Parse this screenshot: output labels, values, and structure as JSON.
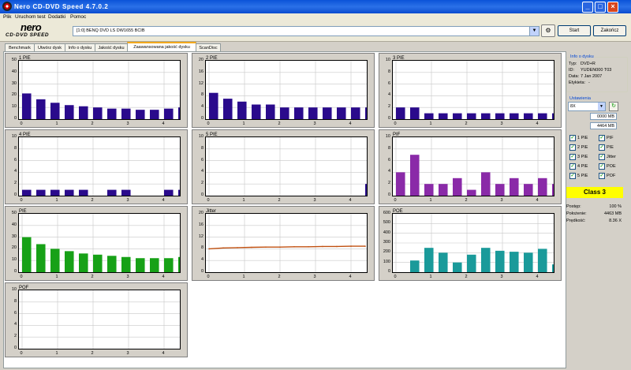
{
  "window": {
    "title": "Nero CD-DVD Speed 4.7.0.2"
  },
  "menu": [
    "Plik",
    "Uruchom test",
    "Dodatki",
    "Pomoc"
  ],
  "logo": {
    "brand": "nero",
    "product": "CD·DVD SPEED"
  },
  "drive": {
    "selected": "[1:0]  BENQ DVD LS DW1655 BCIB"
  },
  "buttons": {
    "start": "Start",
    "close": "Zakończ"
  },
  "tabs": [
    "Benchmark",
    "Utwórz dysk",
    "Info o dysku",
    "Jakość dysku",
    "Zaawansowana jakość dysku",
    "ScanDisc"
  ],
  "active_tab": 4,
  "disc_info": {
    "heading": "Info o dysku",
    "rows": [
      {
        "label": "Typ:",
        "value": "DVD+R"
      },
      {
        "label": "ID:",
        "value": "YUDEN000 T03"
      },
      {
        "label": "Data:",
        "value": "7 Jan 2007"
      },
      {
        "label": "Etykieta:",
        "value": "-"
      }
    ]
  },
  "settings": {
    "heading": "Ustawienia",
    "speed": "8X",
    "start_mb": "0000 MB",
    "end_mb": "4464 MB",
    "checkboxes": [
      {
        "label": "1 PIE",
        "checked": true
      },
      {
        "label": "PIF",
        "checked": true
      },
      {
        "label": "2 PIE",
        "checked": true
      },
      {
        "label": "PIE",
        "checked": true
      },
      {
        "label": "3 PIE",
        "checked": true
      },
      {
        "label": "Jitter",
        "checked": true
      },
      {
        "label": "4 PIE",
        "checked": true
      },
      {
        "label": "POE",
        "checked": true
      },
      {
        "label": "5 PIE",
        "checked": true
      },
      {
        "label": "POF",
        "checked": true
      }
    ]
  },
  "quality_class": "Class 3",
  "status": [
    {
      "label": "Postęp:",
      "value": "100 %"
    },
    {
      "label": "Położenie:",
      "value": "4463 MB"
    },
    {
      "label": "Prędkość:",
      "value": "8.36 X"
    }
  ],
  "colors": {
    "pie": "#2a0a8c",
    "pif": "#8a2aa8",
    "pie_total": "#17a117",
    "jitter": "#c05010",
    "poe": "#1a9a9a",
    "class_badge": "#ffff00"
  },
  "chart_data": [
    {
      "type": "bar",
      "title": "1 PIE",
      "yticks": [
        "50",
        "40",
        "30",
        "20",
        "10",
        "0"
      ],
      "ylim": [
        0,
        50
      ],
      "xticks": [
        "0",
        "1",
        "2",
        "3",
        "4"
      ],
      "xlim": [
        0,
        4.4
      ],
      "series": [
        {
          "x": [
            0,
            0.4,
            0.8,
            1.2,
            1.6,
            2.0,
            2.4,
            2.8,
            3.2,
            3.6,
            4.0,
            4.4
          ],
          "values": [
            22,
            17,
            14,
            12,
            11,
            10,
            9,
            9,
            8,
            8,
            9,
            10
          ]
        }
      ]
    },
    {
      "type": "bar",
      "title": "2 PIE",
      "yticks": [
        "20",
        "16",
        "12",
        "8",
        "4",
        "0"
      ],
      "ylim": [
        0,
        20
      ],
      "xticks": [
        "0",
        "1",
        "2",
        "3",
        "4"
      ],
      "xlim": [
        0,
        4.4
      ],
      "series": [
        {
          "x": [
            0,
            0.4,
            0.8,
            1.2,
            1.6,
            2.0,
            2.4,
            2.8,
            3.2,
            3.6,
            4.0,
            4.4
          ],
          "values": [
            9,
            7,
            6,
            5,
            5,
            4,
            4,
            4,
            4,
            4,
            4,
            4
          ]
        }
      ]
    },
    {
      "type": "bar",
      "title": "3 PIE",
      "yticks": [
        "10",
        "8",
        "6",
        "4",
        "2",
        "0"
      ],
      "ylim": [
        0,
        10
      ],
      "xticks": [
        "0",
        "1",
        "2",
        "3",
        "4"
      ],
      "xlim": [
        0,
        4.4
      ],
      "series": [
        {
          "x": [
            0,
            0.4,
            0.8,
            1.2,
            1.6,
            2.0,
            2.4,
            2.8,
            3.2,
            3.6,
            4.0,
            4.4
          ],
          "values": [
            2,
            2,
            1,
            1,
            1,
            1,
            1,
            1,
            1,
            1,
            1,
            1
          ]
        }
      ]
    },
    {
      "type": "bar",
      "title": "4 PIE",
      "yticks": [
        "10",
        "8",
        "6",
        "4",
        "2",
        "0"
      ],
      "ylim": [
        0,
        10
      ],
      "xticks": [
        "0",
        "1",
        "2",
        "3",
        "4"
      ],
      "xlim": [
        0,
        4.4
      ],
      "series": [
        {
          "x": [
            0,
            0.4,
            0.8,
            1.2,
            1.6,
            2.0,
            2.4,
            2.8,
            3.2,
            3.6,
            4.0,
            4.4
          ],
          "values": [
            1,
            1,
            1,
            1,
            1,
            0,
            1,
            1,
            0,
            0,
            1,
            1
          ]
        }
      ]
    },
    {
      "type": "bar",
      "title": "5 PIE",
      "yticks": [
        "10",
        "8",
        "6",
        "4",
        "2",
        "0"
      ],
      "ylim": [
        0,
        10
      ],
      "xticks": [
        "0",
        "1",
        "2",
        "3",
        "4"
      ],
      "xlim": [
        0,
        4.4
      ],
      "series": [
        {
          "x": [
            0,
            0.4,
            0.8,
            1.2,
            1.6,
            2.0,
            2.4,
            2.8,
            3.2,
            3.6,
            4.0,
            4.4
          ],
          "values": [
            0,
            0,
            0,
            0,
            0,
            0,
            0,
            0,
            0,
            0,
            0,
            2
          ]
        }
      ]
    },
    {
      "type": "bar",
      "title": "PIF",
      "yticks": [
        "10",
        "8",
        "6",
        "4",
        "2",
        "0"
      ],
      "ylim": [
        0,
        10
      ],
      "xticks": [
        "0",
        "1",
        "2",
        "3",
        "4"
      ],
      "xlim": [
        0,
        4.4
      ],
      "series": [
        {
          "x": [
            0,
            0.4,
            0.8,
            1.2,
            1.6,
            2.0,
            2.4,
            2.8,
            3.2,
            3.6,
            4.0,
            4.4
          ],
          "values": [
            4,
            7,
            2,
            2,
            3,
            1,
            4,
            2,
            3,
            2,
            3,
            2
          ]
        }
      ]
    },
    {
      "type": "bar",
      "title": "PIE",
      "yticks": [
        "50",
        "40",
        "30",
        "20",
        "10",
        "0"
      ],
      "ylim": [
        0,
        50
      ],
      "xticks": [
        "0",
        "1",
        "2",
        "3",
        "4"
      ],
      "xlim": [
        0,
        4.4
      ],
      "series": [
        {
          "x": [
            0,
            0.4,
            0.8,
            1.2,
            1.6,
            2.0,
            2.4,
            2.8,
            3.2,
            3.6,
            4.0,
            4.4
          ],
          "values": [
            30,
            24,
            20,
            18,
            16,
            15,
            14,
            13,
            12,
            12,
            12,
            13
          ]
        }
      ]
    },
    {
      "type": "line",
      "title": "Jitter",
      "yticks": [
        "20",
        "16",
        "12",
        "8",
        "4",
        "0"
      ],
      "ylim": [
        0,
        20
      ],
      "xticks": [
        "0",
        "1",
        "2",
        "3",
        "4"
      ],
      "xlim": [
        0,
        4.4
      ],
      "series": [
        {
          "x": [
            0,
            0.4,
            0.8,
            1.2,
            1.6,
            2.0,
            2.4,
            2.8,
            3.2,
            3.6,
            4.0,
            4.4
          ],
          "values": [
            8,
            8.3,
            8.4,
            8.5,
            8.6,
            8.6,
            8.7,
            8.7,
            8.8,
            8.8,
            8.9,
            8.9
          ]
        }
      ]
    },
    {
      "type": "bar",
      "title": "POE",
      "yticks": [
        "600",
        "500",
        "400",
        "300",
        "200",
        "100",
        "0"
      ],
      "ylim": [
        0,
        600
      ],
      "xticks": [
        "0",
        "1",
        "2",
        "3",
        "4"
      ],
      "xlim": [
        0,
        4.4
      ],
      "series": [
        {
          "x": [
            0,
            0.4,
            0.8,
            1.2,
            1.6,
            2.0,
            2.4,
            2.8,
            3.2,
            3.6,
            4.0,
            4.4
          ],
          "values": [
            0,
            120,
            250,
            200,
            100,
            180,
            250,
            220,
            210,
            200,
            240,
            80
          ]
        }
      ]
    },
    {
      "type": "bar",
      "title": "POF",
      "yticks": [
        "10",
        "8",
        "6",
        "4",
        "2",
        "0"
      ],
      "ylim": [
        0,
        10
      ],
      "xticks": [
        "0",
        "1",
        "2",
        "3",
        "4"
      ],
      "xlim": [
        0,
        4.4
      ],
      "series": [
        {
          "x": [
            0,
            0.4,
            0.8,
            1.2,
            1.6,
            2.0,
            2.4,
            2.8,
            3.2,
            3.6,
            4.0,
            4.4
          ],
          "values": [
            0,
            0,
            0,
            0,
            0,
            0,
            0,
            0,
            0,
            0,
            0,
            0
          ]
        }
      ]
    }
  ]
}
